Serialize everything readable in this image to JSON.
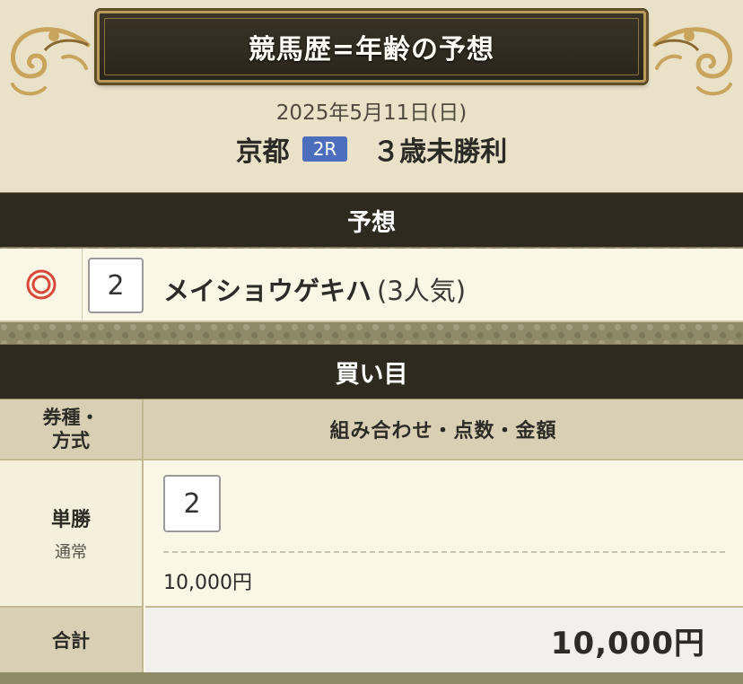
{
  "title": "競馬歴=年齢の予想",
  "race": {
    "date": "2025年5月11日(日)",
    "venue": "京都",
    "race_number": "2R",
    "race_name": "３歳未勝利"
  },
  "prediction_section": {
    "heading": "予想",
    "pick": {
      "mark": "◎",
      "horse_number": "2",
      "horse_name": "メイショウゲキハ",
      "popularity": "(3人気)"
    }
  },
  "bets_section": {
    "heading": "買い目",
    "col_type_line1": "券種・",
    "col_type_line2": "方式",
    "col_detail": "組み合わせ・点数・金額",
    "bet": {
      "type": "単勝",
      "method": "通常",
      "combination": "2",
      "amount": "10,000円"
    },
    "total_label": "合計",
    "total_value": "10,000円"
  },
  "colors": {
    "race_badge": "#4c6fbd",
    "mark_red": "#d9493a",
    "header_dark": "#2e2a1f",
    "gold": "#b99a5a"
  }
}
